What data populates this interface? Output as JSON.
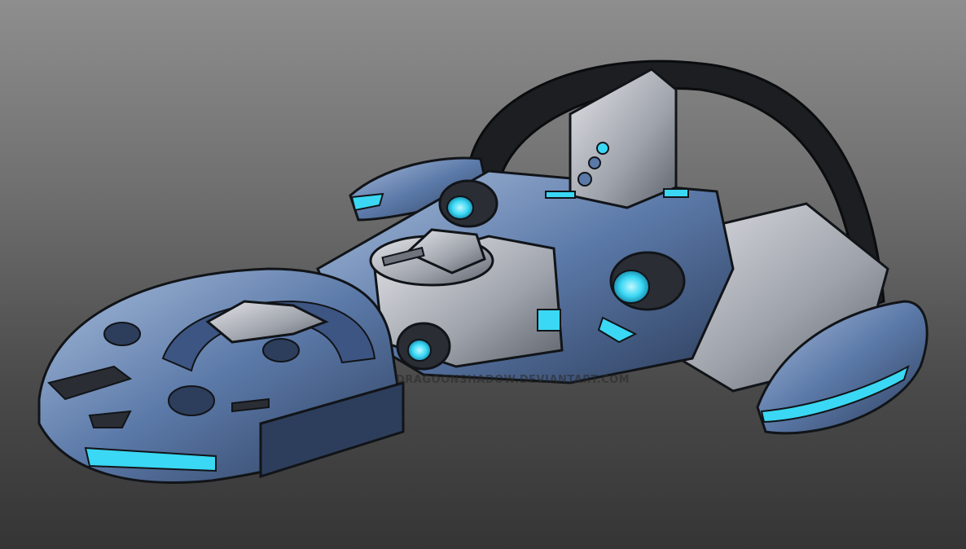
{
  "scene": {
    "subject": "spaceship-illustration",
    "watermark_text": "DRAGOONSHADOW.DEVIANTART.COM"
  },
  "palette": {
    "background_top": "#8e8e8e",
    "background_bottom": "#353535",
    "hull_blue": "#5b79a8",
    "hull_dark": "#2d3e5c",
    "hull_light": "#a9bedc",
    "metal_grey": "#b9bcc2",
    "glow_cyan": "#3ad8f4",
    "outline": "#111418"
  }
}
